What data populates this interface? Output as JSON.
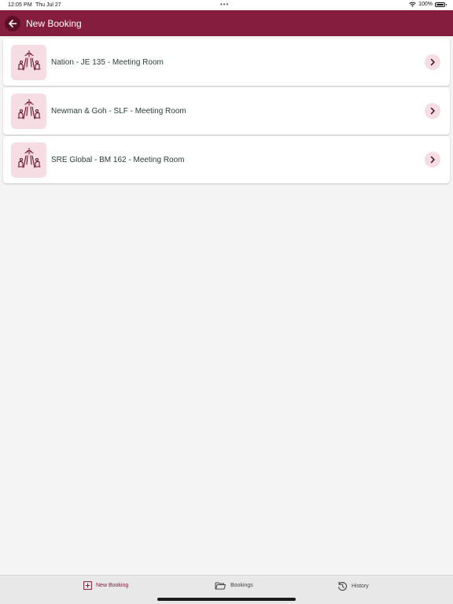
{
  "status_bar": {
    "time": "12:05 PM",
    "date": "Thu Jul 27",
    "battery": "100%"
  },
  "header": {
    "title": "New Booking"
  },
  "rooms": [
    {
      "label": "Nation - JE 135 - Meeting Room"
    },
    {
      "label": "Newman & Goh - SLF - Meeting Room"
    },
    {
      "label": "SRE Global - BM 162 - Meeting Room"
    }
  ],
  "tabs": {
    "new_booking": "New Booking",
    "bookings": "Bookings",
    "history": "History"
  },
  "colors": {
    "brand": "#851d3e",
    "brand_dark": "#5d0f28",
    "icon_bg": "#f6dce3"
  },
  "icons": {
    "back": "arrow-left-icon",
    "room": "meeting-room-icon",
    "chevron": "chevron-right-icon",
    "new_booking": "plus-square-icon",
    "bookings": "folder-icon",
    "history": "history-icon"
  }
}
